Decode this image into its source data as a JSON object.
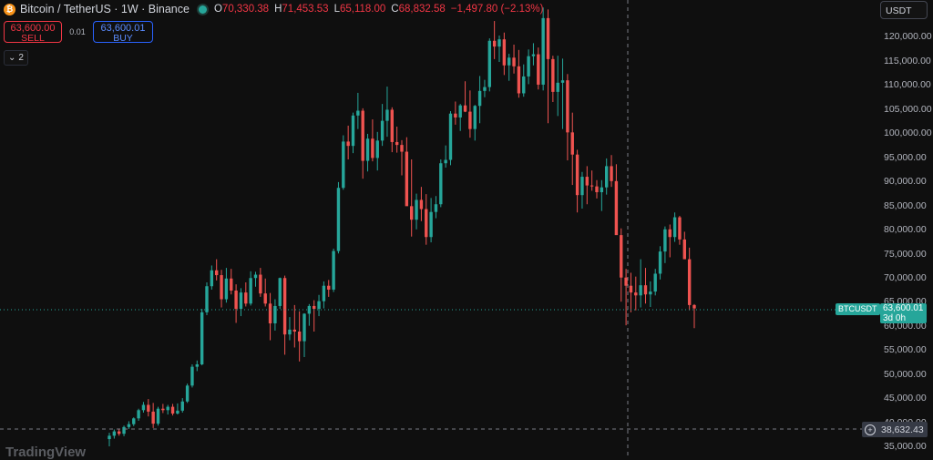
{
  "header": {
    "coin_icon": "bitcoin-icon",
    "symbol": "Bitcoin / TetherUS · 1W · Binance",
    "status_color": "#26a69a",
    "ohlc": [
      {
        "k": "O",
        "v": "70,330.38"
      },
      {
        "k": "H",
        "v": "71,453.53"
      },
      {
        "k": "L",
        "v": "65,118.00"
      },
      {
        "k": "C",
        "v": "68,832.58"
      },
      {
        "k": "",
        "v": "−1,497.80 (−2.13%)"
      }
    ]
  },
  "trade": {
    "sell_price": "63,600.00",
    "sell_label": "SELL",
    "spread": "0.01",
    "buy_price": "63,600.01",
    "buy_label": "BUY"
  },
  "collapse": {
    "icon": "chevron-down-icon",
    "count": "2"
  },
  "currency": "USDT",
  "colors": {
    "up": "#26a69a",
    "down": "#ef5350",
    "background": "#0f0f0f",
    "sell": "#f23645",
    "buy": "#2962ff"
  },
  "price_axis": [
    "120,000.00",
    "115,000.00",
    "110,000.00",
    "105,000.00",
    "100,000.00",
    "95,000.00",
    "90,000.00",
    "85,000.00",
    "80,000.00",
    "75,000.00",
    "70,000.00",
    "65,000.00",
    "60,000.00",
    "55,000.00",
    "50,000.00",
    "45,000.00",
    "40,000.00",
    "35,000.00"
  ],
  "current": {
    "symbol": "BTCUSDT",
    "price": "63,600.01",
    "countdown": "3d 0h"
  },
  "crosshair_price": "38,632.43",
  "watermark": "TradingView",
  "chart_data": {
    "type": "candlestick",
    "ylim": [
      34000,
      126000
    ],
    "grid": false,
    "candles": [
      [
        36500,
        37800,
        35000,
        37200
      ],
      [
        37200,
        38500,
        36600,
        38100
      ],
      [
        38100,
        38700,
        37200,
        37600
      ],
      [
        37600,
        39300,
        37100,
        39000
      ],
      [
        39000,
        40200,
        38600,
        39600
      ],
      [
        39600,
        41000,
        39200,
        40800
      ],
      [
        40800,
        42800,
        40300,
        42500
      ],
      [
        42500,
        44200,
        42000,
        43600
      ],
      [
        43600,
        44800,
        41200,
        42200
      ],
      [
        42200,
        44000,
        38800,
        39700
      ],
      [
        39700,
        43200,
        39300,
        42800
      ],
      [
        42800,
        43800,
        41900,
        42500
      ],
      [
        42500,
        43600,
        41600,
        43200
      ],
      [
        43200,
        43800,
        41400,
        41800
      ],
      [
        41800,
        43900,
        41600,
        42400
      ],
      [
        42400,
        45000,
        42000,
        44300
      ],
      [
        44300,
        48000,
        44000,
        47600
      ],
      [
        47600,
        52000,
        47200,
        51500
      ],
      [
        51500,
        52800,
        50600,
        52000
      ],
      [
        52000,
        63500,
        51800,
        62800
      ],
      [
        62800,
        69000,
        62200,
        68200
      ],
      [
        68200,
        72500,
        67500,
        71500
      ],
      [
        71500,
        73800,
        69400,
        70500
      ],
      [
        70500,
        71600,
        63800,
        65500
      ],
      [
        65500,
        72000,
        64800,
        69800
      ],
      [
        69800,
        71800,
        66500,
        67300
      ],
      [
        67300,
        68600,
        60600,
        63500
      ],
      [
        63500,
        67800,
        62000,
        66900
      ],
      [
        66900,
        69000,
        64000,
        64600
      ],
      [
        64600,
        71300,
        64200,
        69900
      ],
      [
        69900,
        71200,
        68100,
        70600
      ],
      [
        70600,
        72000,
        66000,
        66700
      ],
      [
        66700,
        69800,
        64000,
        64600
      ],
      [
        64600,
        66800,
        57000,
        60500
      ],
      [
        60500,
        65500,
        59000,
        64100
      ],
      [
        64100,
        70000,
        63500,
        69900
      ],
      [
        69900,
        70400,
        54000,
        58200
      ],
      [
        58200,
        61800,
        57000,
        59200
      ],
      [
        59200,
        64300,
        55500,
        58800
      ],
      [
        58800,
        63000,
        52600,
        56800
      ],
      [
        56800,
        62600,
        53500,
        62500
      ],
      [
        62500,
        64500,
        60000,
        64100
      ],
      [
        64100,
        65300,
        58800,
        63500
      ],
      [
        63500,
        66400,
        62000,
        65100
      ],
      [
        65100,
        69200,
        63600,
        68300
      ],
      [
        68300,
        69500,
        66000,
        67500
      ],
      [
        67500,
        76000,
        67000,
        75500
      ],
      [
        75500,
        89800,
        75000,
        88600
      ],
      [
        88600,
        99500,
        88200,
        98200
      ],
      [
        98200,
        101500,
        94500,
        97300
      ],
      [
        97300,
        104200,
        95800,
        103600
      ],
      [
        103600,
        108300,
        100800,
        104600
      ],
      [
        104600,
        105100,
        90500,
        94200
      ],
      [
        94200,
        99800,
        92000,
        98800
      ],
      [
        98800,
        102800,
        94100,
        94800
      ],
      [
        94800,
        100200,
        92200,
        98400
      ],
      [
        98400,
        106000,
        97300,
        102500
      ],
      [
        102500,
        109600,
        99200,
        104800
      ],
      [
        104800,
        105300,
        96000,
        98100
      ],
      [
        98100,
        101300,
        95900,
        97500
      ],
      [
        97500,
        98500,
        91200,
        96100
      ],
      [
        96100,
        99100,
        86000,
        84800
      ],
      [
        84800,
        94500,
        78500,
        82000
      ],
      [
        82000,
        87400,
        80000,
        86100
      ],
      [
        86100,
        88800,
        81700,
        84200
      ],
      [
        84200,
        87300,
        76800,
        78400
      ],
      [
        78400,
        86500,
        77300,
        83600
      ],
      [
        83600,
        86900,
        82300,
        85200
      ],
      [
        85200,
        94500,
        84600,
        93700
      ],
      [
        93700,
        97400,
        92800,
        94400
      ],
      [
        94400,
        104500,
        93300,
        104000
      ],
      [
        104000,
        106500,
        101700,
        103200
      ],
      [
        103200,
        106000,
        100400,
        105700
      ],
      [
        105700,
        110700,
        104300,
        104400
      ],
      [
        104400,
        108800,
        99000,
        100800
      ],
      [
        100800,
        105800,
        98400,
        105600
      ],
      [
        105600,
        111800,
        102000,
        108700
      ],
      [
        108700,
        111000,
        107400,
        109500
      ],
      [
        109500,
        119600,
        108600,
        119100
      ],
      [
        119100,
        123200,
        115300,
        117900
      ],
      [
        117900,
        120200,
        114700,
        119400
      ],
      [
        119400,
        120800,
        112000,
        114000
      ],
      [
        114000,
        116400,
        110800,
        115600
      ],
      [
        115600,
        118300,
        112300,
        113800
      ],
      [
        113800,
        117200,
        107300,
        108200
      ],
      [
        108200,
        114200,
        107500,
        111700
      ],
      [
        111700,
        117300,
        110100,
        115900
      ],
      [
        115900,
        118600,
        114000,
        116300
      ],
      [
        116300,
        117700,
        109000,
        110000
      ],
      [
        110000,
        126000,
        108800,
        123800
      ],
      [
        123800,
        125600,
        102000,
        115300
      ],
      [
        115300,
        116000,
        106400,
        108500
      ],
      [
        108500,
        116000,
        103500,
        110400
      ],
      [
        110400,
        115400,
        100800,
        110900
      ],
      [
        110900,
        112200,
        94300,
        100100
      ],
      [
        100100,
        104200,
        89200,
        95500
      ],
      [
        95500,
        96500,
        83500,
        87100
      ],
      [
        87100,
        91900,
        84300,
        90900
      ],
      [
        90900,
        93100,
        85200,
        89100
      ],
      [
        89100,
        92200,
        88000,
        88900
      ],
      [
        88900,
        90200,
        86400,
        87700
      ],
      [
        87700,
        90200,
        83800,
        88700
      ],
      [
        88700,
        94700,
        87200,
        93100
      ],
      [
        93100,
        95400,
        88800,
        90000
      ],
      [
        90000,
        93500,
        81000,
        78800
      ],
      [
        78800,
        80200,
        65000,
        70000
      ],
      [
        70000,
        71800,
        60100,
        68300
      ],
      [
        68300,
        71000,
        62800,
        66900
      ],
      [
        66900,
        70200,
        63200,
        66300
      ],
      [
        66300,
        73800,
        63800,
        68400
      ],
      [
        68400,
        72000,
        64600,
        66500
      ],
      [
        66500,
        69200,
        63900,
        67100
      ],
      [
        67100,
        71800,
        66300,
        70800
      ],
      [
        70800,
        76500,
        69600,
        75400
      ],
      [
        75400,
        80600,
        73000,
        80000
      ],
      [
        80000,
        81000,
        74200,
        78400
      ],
      [
        78400,
        83500,
        77400,
        82500
      ],
      [
        82500,
        82800,
        76800,
        77900
      ],
      [
        77900,
        79500,
        74300,
        73800
      ],
      [
        73800,
        76200,
        63200,
        64300
      ],
      [
        64300,
        64500,
        59500,
        63600
      ]
    ]
  }
}
